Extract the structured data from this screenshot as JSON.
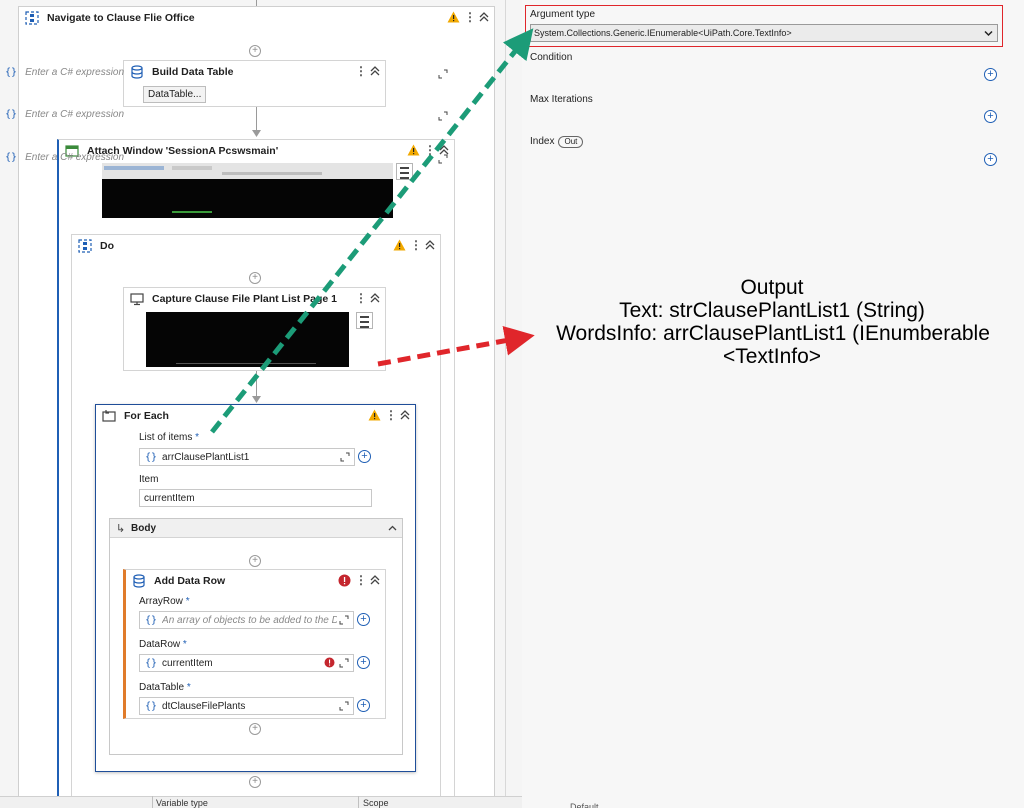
{
  "workflow": {
    "navigate": {
      "title": "Navigate to Clause Flie Office"
    },
    "build_data_table": {
      "title": "Build Data Table",
      "button": "DataTable..."
    },
    "attach_window": {
      "title": "Attach Window 'SessionA  Pcswsmain'"
    },
    "do": {
      "title": "Do"
    },
    "capture": {
      "title": "Capture Clause File Plant List Page 1"
    },
    "for_each": {
      "title": "For Each",
      "list_label": "List of items",
      "list_value": "arrClausePlantList1",
      "item_label": "Item",
      "item_value": "currentItem",
      "body_label": "Body"
    },
    "add_data_row": {
      "title": "Add Data Row",
      "array_row_label": "ArrayRow",
      "array_row_placeholder": "An array of objects to be added to the Dat",
      "data_row_label": "DataRow",
      "data_row_value": "currentItem",
      "data_table_label": "DataTable",
      "data_table_value": "dtClauseFilePlants"
    },
    "required_mark": "*",
    "braces": "{}",
    "kebab": "⋮",
    "plus": "+"
  },
  "variables_bar": {
    "col_type": "Variable type",
    "col_scope": "Scope"
  },
  "properties": {
    "argument_type_label": "Argument type",
    "argument_type_value": "System.Collections.Generic.IEnumerable<UiPath.Core.TextInfo>",
    "condition_label": "Condition",
    "max_iterations_label": "Max Iterations",
    "index_label": "Index",
    "index_badge": "Out",
    "expression_placeholder": "Enter a C# expression",
    "default_col": "Default"
  },
  "annotation": {
    "line1": "Output",
    "line2": "Text: strClausePlantList1 (String)",
    "line3": "WordsInfo: arrClausePlantList1 (IEnumberable",
    "line4": "<TextInfo>"
  },
  "colors": {
    "accent": "#1f5fb5",
    "highlight_border": "#e0262b",
    "green_arrow": "#1c9c78",
    "red_arrow": "#e0262b",
    "warning": "#f2a900",
    "error": "#c4262e"
  }
}
